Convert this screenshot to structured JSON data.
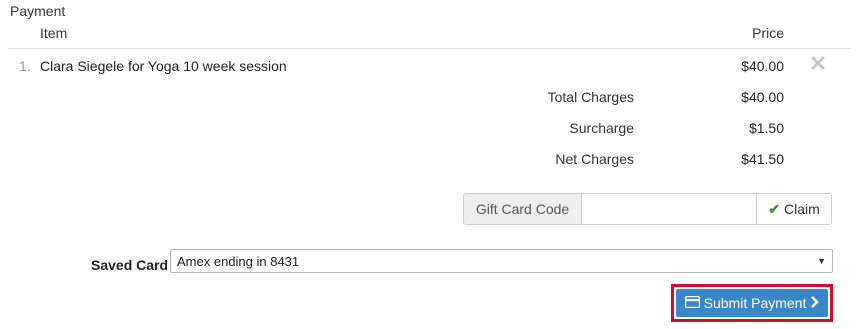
{
  "payment": {
    "section_title": "Payment",
    "columns": {
      "item": "Item",
      "price": "Price"
    },
    "rows": [
      {
        "num": "1.",
        "name": "Clara Siegele for Yoga 10 week session",
        "price": "$40.00"
      }
    ],
    "summary": [
      {
        "label": "Total Charges",
        "value": "$40.00"
      },
      {
        "label": "Surcharge",
        "value": "$1.50"
      },
      {
        "label": "Net Charges",
        "value": "$41.50"
      }
    ]
  },
  "gift_card": {
    "addon_label": "Gift Card Code",
    "input_value": "",
    "claim_label": "Claim"
  },
  "saved_card": {
    "label": "Saved Card",
    "selected": "Amex ending in 8431"
  },
  "submit": {
    "label": "Submit Payment"
  },
  "icons": {
    "remove": "close-icon",
    "claim": "checkmark-icon",
    "card": "credit-card-icon",
    "submit_arrow": "chevron-right-icon",
    "select": "caret-down-icon"
  },
  "colors": {
    "submit_bg": "#3a87c7",
    "highlight_border": "#c8102e",
    "check": "#3c8d3c"
  }
}
